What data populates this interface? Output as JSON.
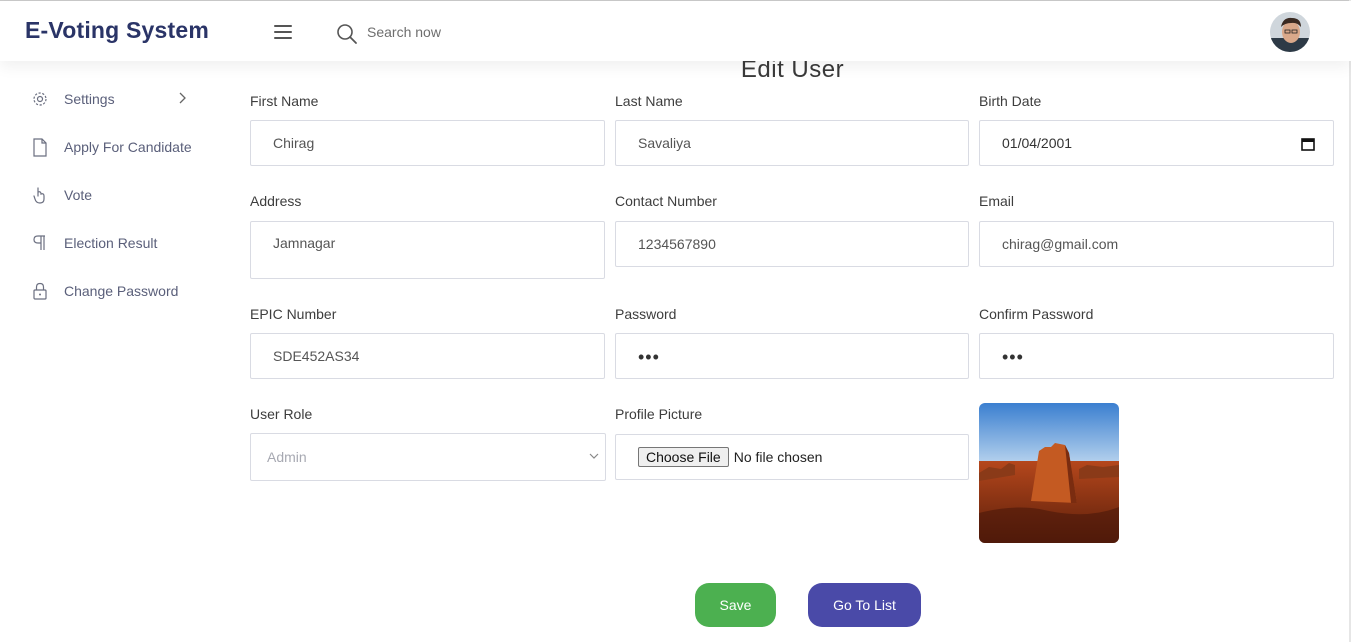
{
  "header": {
    "brand": "E-Voting System",
    "search_placeholder": "Search now"
  },
  "sidebar": {
    "items": [
      {
        "label": "Settings",
        "icon": "gear-icon",
        "has_chevron": true
      },
      {
        "label": "Apply For Candidate",
        "icon": "document-icon"
      },
      {
        "label": "Vote",
        "icon": "hand-icon"
      },
      {
        "label": "Election Result",
        "icon": "paragraph-icon"
      },
      {
        "label": "Change Password",
        "icon": "lock-icon"
      }
    ]
  },
  "form": {
    "title": "Edit User",
    "first_name": {
      "label": "First Name",
      "value": "Chirag"
    },
    "last_name": {
      "label": "Last Name",
      "value": "Savaliya"
    },
    "birth_date": {
      "label": "Birth Date",
      "value": "01/04/2001"
    },
    "address": {
      "label": "Address",
      "value": "Jamnagar"
    },
    "contact": {
      "label": "Contact Number",
      "value": "1234567890"
    },
    "email": {
      "label": "Email",
      "value": "chirag@gmail.com"
    },
    "epic": {
      "label": "EPIC Number",
      "value": "SDE452AS34"
    },
    "password": {
      "label": "Password",
      "value": "•••"
    },
    "confirm_password": {
      "label": "Confirm Password",
      "value": "•••"
    },
    "user_role": {
      "label": "User Role",
      "value": "Admin"
    },
    "profile_picture": {
      "label": "Profile Picture",
      "button": "Choose File",
      "status": "No file chosen"
    },
    "save_label": "Save",
    "list_label": "Go To List"
  },
  "colors": {
    "brand": "#2a3467",
    "save": "#4cb050",
    "go_to_list": "#4a4aa8"
  }
}
